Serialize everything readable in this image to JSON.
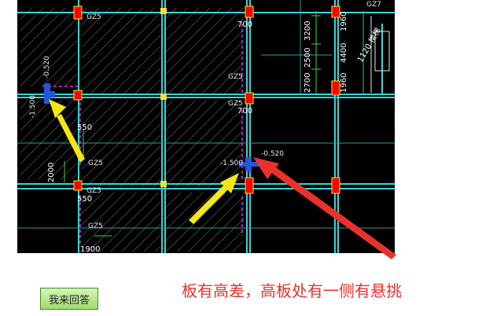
{
  "annotation": {
    "text": "板有高差，高板处有一侧有悬挑"
  },
  "answer_button": {
    "label": "我来回答"
  },
  "drawing": {
    "column_labels": [
      "GZ5",
      "GZ5",
      "GZ5",
      "GZ5",
      "GZ5",
      "GZ5",
      "GZ5"
    ],
    "dimensions": [
      "700",
      "700",
      "550",
      "550",
      "2000",
      "1900",
      "3200",
      "2500",
      "2700",
      "1960",
      "4400",
      "1960",
      "1120 楼梯"
    ],
    "elevations": [
      "-1.500",
      "-0.520",
      "-1.500",
      "-0.520"
    ],
    "top_label": "GZ7",
    "colors": {
      "background": "#000000",
      "column": "#ff0000",
      "arrow": "#f5e61a",
      "red_arrow": "#e8322c",
      "beam": "#34d6d6"
    }
  }
}
